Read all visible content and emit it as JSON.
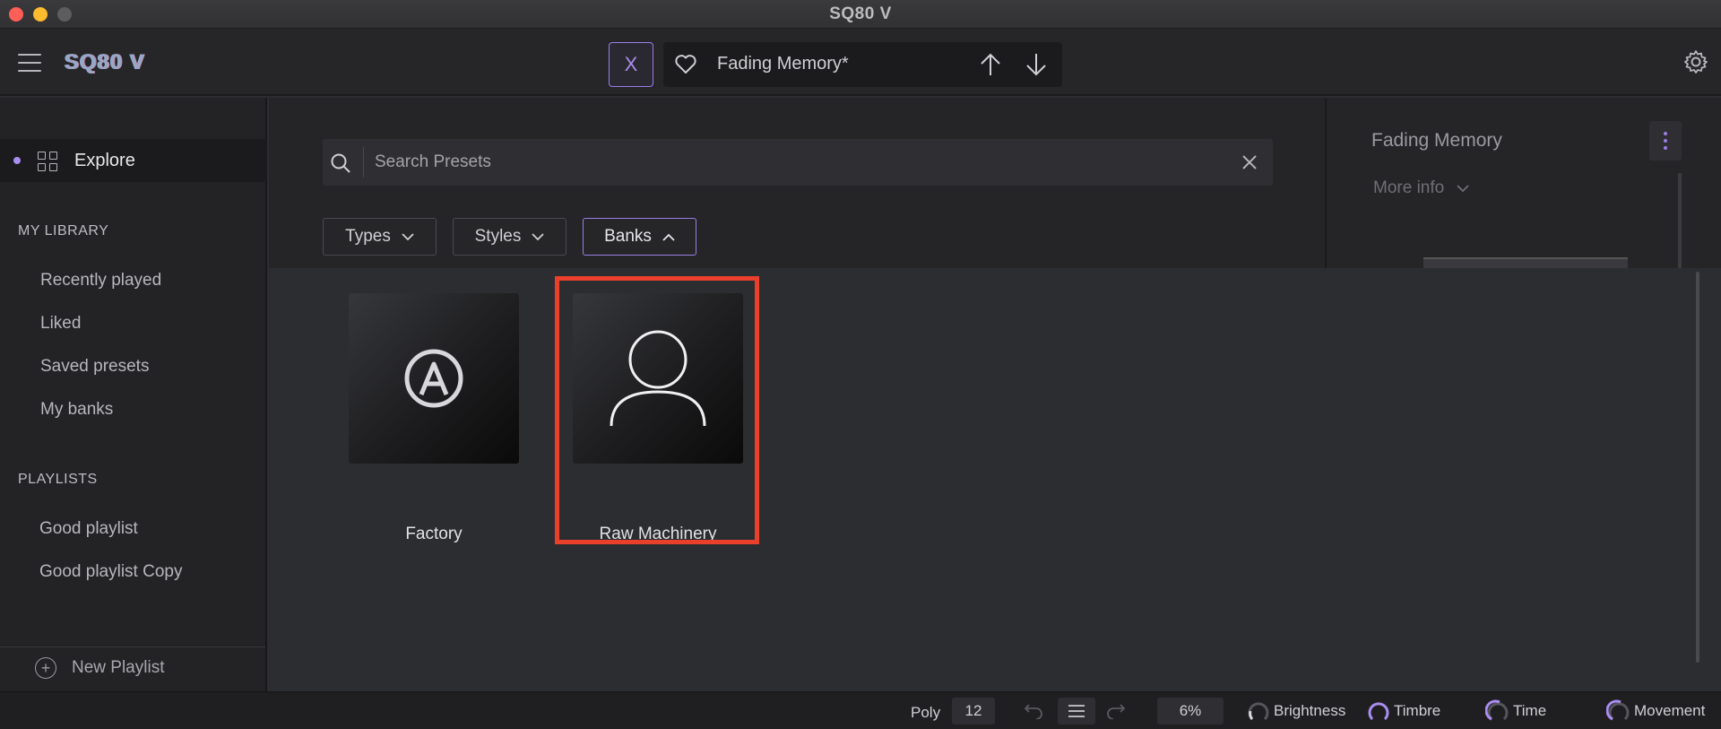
{
  "window": {
    "title": "SQ80 V"
  },
  "toolbar": {
    "logo": "SQ80 V",
    "x_button_label": "X",
    "preset_name": "Fading Memory*"
  },
  "sidebar": {
    "explore_label": "Explore",
    "library_header": "MY LIBRARY",
    "library_items": [
      "Recently played",
      "Liked",
      "Saved presets",
      "My banks"
    ],
    "playlists_header": "PLAYLISTS",
    "playlists": [
      "Good playlist",
      "Good playlist Copy"
    ],
    "new_playlist_label": "New Playlist"
  },
  "browser": {
    "search_placeholder": "Search Presets",
    "filters": [
      "Types",
      "Styles",
      "Banks"
    ],
    "banks": [
      {
        "name": "Factory",
        "icon": "arturia-logo-icon"
      },
      {
        "name": "Raw Machinery",
        "icon": "user-icon"
      }
    ]
  },
  "right_panel": {
    "title": "Fading Memory",
    "more_info": "More info"
  },
  "status_bar": {
    "poly_label": "Poly",
    "poly_value": "12",
    "cpu": "6%",
    "macros": [
      "Brightness",
      "Timbre",
      "Time",
      "Movement"
    ]
  },
  "colors": {
    "accent": "#9b7ee6",
    "highlight_box": "#e8402a"
  }
}
